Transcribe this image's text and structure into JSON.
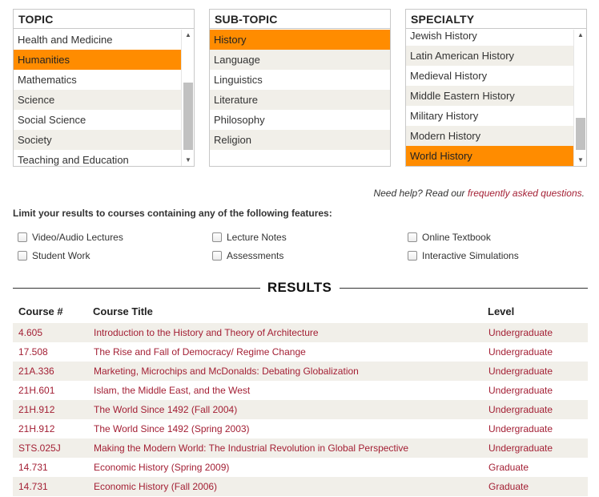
{
  "topic": {
    "header": "TOPIC",
    "items": [
      {
        "label": "Health and Medicine",
        "selected": false
      },
      {
        "label": "Humanities",
        "selected": true
      },
      {
        "label": "Mathematics",
        "selected": false
      },
      {
        "label": "Science",
        "selected": false
      },
      {
        "label": "Social Science",
        "selected": false
      },
      {
        "label": "Society",
        "selected": false
      },
      {
        "label": "Teaching and Education",
        "selected": false
      }
    ]
  },
  "subtopic": {
    "header": "SUB-TOPIC",
    "items": [
      {
        "label": "History",
        "selected": true
      },
      {
        "label": "Language",
        "selected": false
      },
      {
        "label": "Linguistics",
        "selected": false
      },
      {
        "label": "Literature",
        "selected": false
      },
      {
        "label": "Philosophy",
        "selected": false
      },
      {
        "label": "Religion",
        "selected": false
      }
    ]
  },
  "specialty": {
    "header": "SPECIALTY",
    "items": [
      {
        "label": "Jewish History",
        "selected": false
      },
      {
        "label": "Latin American History",
        "selected": false
      },
      {
        "label": "Medieval History",
        "selected": false
      },
      {
        "label": "Middle Eastern History",
        "selected": false
      },
      {
        "label": "Military History",
        "selected": false
      },
      {
        "label": "Modern History",
        "selected": false
      },
      {
        "label": "World History",
        "selected": true
      }
    ]
  },
  "help": {
    "prefix": "Need help? Read our ",
    "link": "frequently asked questions",
    "suffix": "."
  },
  "features": {
    "label": "Limit your results to courses containing any of the following features:",
    "options": [
      {
        "label": "Video/Audio Lectures",
        "checked": false
      },
      {
        "label": "Lecture Notes",
        "checked": false
      },
      {
        "label": "Online Textbook",
        "checked": false
      },
      {
        "label": "Student Work",
        "checked": false
      },
      {
        "label": "Assessments",
        "checked": false
      },
      {
        "label": "Interactive Simulations",
        "checked": false
      }
    ]
  },
  "results": {
    "title": "RESULTS",
    "columns": [
      "Course #",
      "Course Title",
      "Level"
    ],
    "rows": [
      {
        "num": "4.605",
        "title": "Introduction to the History and Theory of Architecture",
        "level": "Undergraduate"
      },
      {
        "num": "17.508",
        "title": "The Rise and Fall of Democracy/ Regime Change",
        "level": "Undergraduate"
      },
      {
        "num": "21A.336",
        "title": "Marketing, Microchips and McDonalds: Debating Globalization",
        "level": "Undergraduate"
      },
      {
        "num": "21H.601",
        "title": "Islam, the Middle East, and the West",
        "level": "Undergraduate"
      },
      {
        "num": "21H.912",
        "title": "The World Since 1492 (Fall 2004)",
        "level": "Undergraduate"
      },
      {
        "num": "21H.912",
        "title": "The World Since 1492 (Spring 2003)",
        "level": "Undergraduate"
      },
      {
        "num": "STS.025J",
        "title": "Making the Modern World: The Industrial Revolution in Global Perspective",
        "level": "Undergraduate"
      },
      {
        "num": "14.731",
        "title": "Economic History (Spring 2009)",
        "level": "Graduate"
      },
      {
        "num": "14.731",
        "title": "Economic History (Fall 2006)",
        "level": "Graduate"
      }
    ]
  },
  "colors": {
    "selected": "#ff8c00",
    "link": "#a31f34",
    "stripe": "#f1efe9"
  }
}
